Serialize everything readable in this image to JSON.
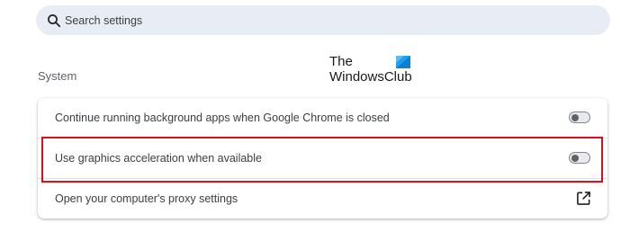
{
  "search": {
    "placeholder": "Search settings",
    "icon": "search-icon"
  },
  "section": {
    "title": "System"
  },
  "watermark": {
    "line1": "The",
    "line2": "WindowsClub",
    "logo_color": "#1f9ef0"
  },
  "settings": [
    {
      "label": "Continue running background apps when Google Chrome is closed",
      "control": "toggle",
      "enabled": false
    },
    {
      "label": "Use graphics acceleration when available",
      "control": "toggle",
      "enabled": false,
      "highlighted": true,
      "highlight_color": "#d9101c"
    },
    {
      "label": "Open your computer's proxy settings",
      "control": "external-link",
      "icon": "open-in-new-icon"
    }
  ]
}
